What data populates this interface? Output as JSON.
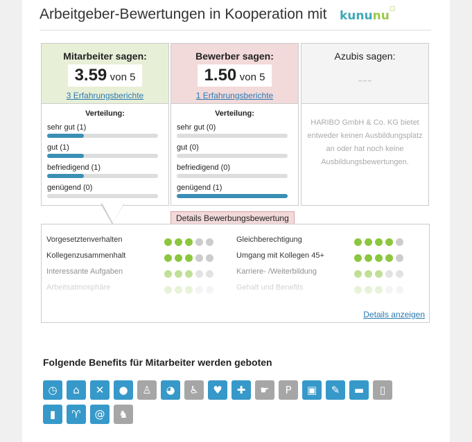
{
  "header": {
    "title": "Arbeitgeber-Bewertungen in Kooperation mit",
    "logo_part1": "kunu",
    "logo_part2": "nu"
  },
  "panels": {
    "employees": {
      "heading": "Mitarbeiter sagen:",
      "score": "3.59",
      "of": "von 5",
      "link": "3 Erfahrungsberichte",
      "dist_title": "Verteilung:",
      "rows": [
        {
          "label": "sehr gut (1)",
          "fill": 0.33
        },
        {
          "label": "gut (1)",
          "fill": 0.33
        },
        {
          "label": "befriedigend (1)",
          "fill": 0.33
        },
        {
          "label": "genügend (0)",
          "fill": 0
        }
      ]
    },
    "applicants": {
      "heading": "Bewerber sagen:",
      "score": "1.50",
      "of": "von 5",
      "link": "1 Erfahrungsberichte",
      "dist_title": "Verteilung:",
      "rows": [
        {
          "label": "sehr gut (0)",
          "fill": 0
        },
        {
          "label": "gut (0)",
          "fill": 0
        },
        {
          "label": "befriedigend (0)",
          "fill": 0
        },
        {
          "label": "genügend (1)",
          "fill": 1
        }
      ]
    },
    "trainees": {
      "heading": "Azubis sagen:",
      "score": "---",
      "message": "HARIBO GmbH & Co. KG bietet entweder keinen Ausbildungsplatz an oder hat noch keine Ausbildungsbewertungen."
    }
  },
  "details": {
    "tab_label": "Details Bewerbungsbewertung",
    "more_link": "Details anzeigen",
    "left": [
      {
        "label": "Vorgesetztenverhalten",
        "rating": 3
      },
      {
        "label": "Kollegenzusammenhalt",
        "rating": 3
      },
      {
        "label": "Interessante Aufgaben",
        "rating": 3
      },
      {
        "label": "Arbeitsatmosphäre",
        "rating": 3
      }
    ],
    "right": [
      {
        "label": "Gleichberechtigung",
        "rating": 4
      },
      {
        "label": "Umgang mit Kollegen 45+",
        "rating": 4
      },
      {
        "label": "Karriere- /Weiterbildung",
        "rating": 3
      },
      {
        "label": "Gehalt und Benefits",
        "rating": 3
      }
    ]
  },
  "benefits": {
    "title": "Folgende Benefits für Mitarbeiter werden geboten",
    "icons": [
      {
        "name": "flexible-hours-icon",
        "glyph": "◷",
        "color": "#3699c9"
      },
      {
        "name": "home-office-icon",
        "glyph": "⌂",
        "color": "#3699c9"
      },
      {
        "name": "canteen-icon",
        "glyph": "✕",
        "color": "#3699c9"
      },
      {
        "name": "food-icon",
        "glyph": "●",
        "color": "#3699c9"
      },
      {
        "name": "childcare-icon",
        "glyph": "♙",
        "color": "#a6a6a6"
      },
      {
        "name": "pension-icon",
        "glyph": "◕",
        "color": "#3699c9"
      },
      {
        "name": "accessibility-icon",
        "glyph": "♿",
        "color": "#a6a6a6"
      },
      {
        "name": "health-icon",
        "glyph": "♥",
        "color": "#3699c9"
      },
      {
        "name": "medical-icon",
        "glyph": "✚",
        "color": "#3699c9"
      },
      {
        "name": "coaching-icon",
        "glyph": "☛",
        "color": "#a6a6a6"
      },
      {
        "name": "parking-icon",
        "glyph": "P",
        "color": "#a6a6a6"
      },
      {
        "name": "transport-icon",
        "glyph": "▣",
        "color": "#3699c9"
      },
      {
        "name": "discount-icon",
        "glyph": "✎",
        "color": "#3699c9"
      },
      {
        "name": "company-car-icon",
        "glyph": "▬",
        "color": "#3699c9"
      },
      {
        "name": "mobile-phone-icon",
        "glyph": "▯",
        "color": "#a6a6a6"
      },
      {
        "name": "profit-sharing-icon",
        "glyph": "▮",
        "color": "#3699c9"
      },
      {
        "name": "events-icon",
        "glyph": "♈",
        "color": "#3699c9"
      },
      {
        "name": "internet-icon",
        "glyph": "@",
        "color": "#3699c9"
      },
      {
        "name": "dog-icon",
        "glyph": "♞",
        "color": "#a6a6a6"
      }
    ]
  }
}
